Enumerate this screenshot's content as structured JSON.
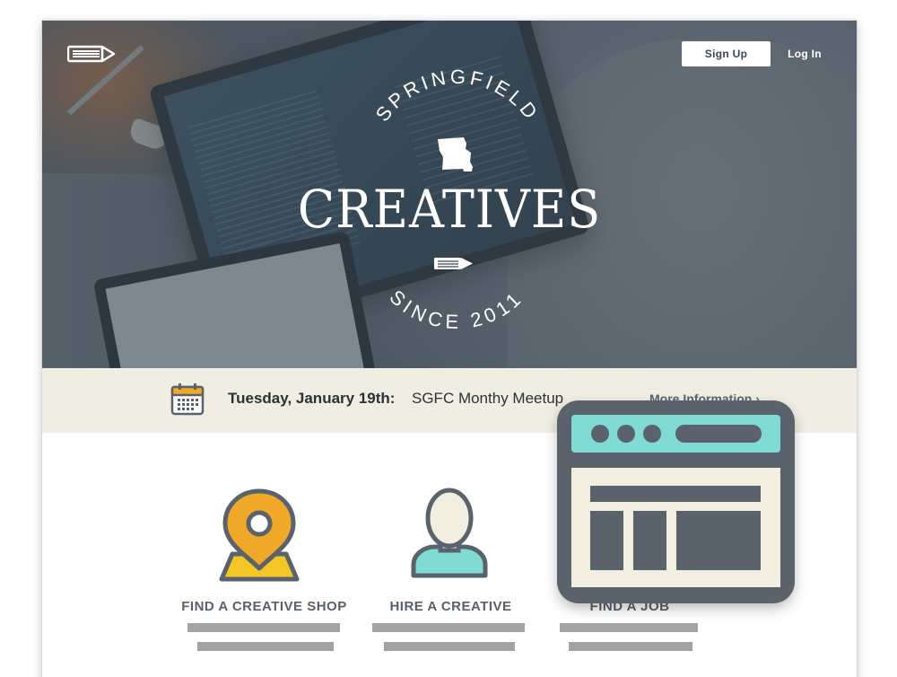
{
  "header": {
    "signup_label": "Sign Up",
    "login_label": "Log In"
  },
  "hero": {
    "arc_top": "SPRINGFIELD",
    "title": "CREATIVES",
    "arc_bottom": "SINCE 2011"
  },
  "event": {
    "date": "Tuesday, January 19th:",
    "name": "SGFC Monthy Meetup",
    "more_label": "More Information ›"
  },
  "features": [
    {
      "label": "FIND A CREATIVE SHOP",
      "icon": "map-pin-icon"
    },
    {
      "label": "HIRE A CREATIVE",
      "icon": "person-icon"
    },
    {
      "label": "FIND A JOB",
      "icon": "browser-icon"
    }
  ],
  "colors": {
    "hero_overlay": "#3c4854",
    "event_bar": "#f0ede2",
    "accent_orange": "#f0a829",
    "accent_teal": "#7fdbd3",
    "icon_gray": "#5a636b",
    "label_gray": "#58616a"
  }
}
